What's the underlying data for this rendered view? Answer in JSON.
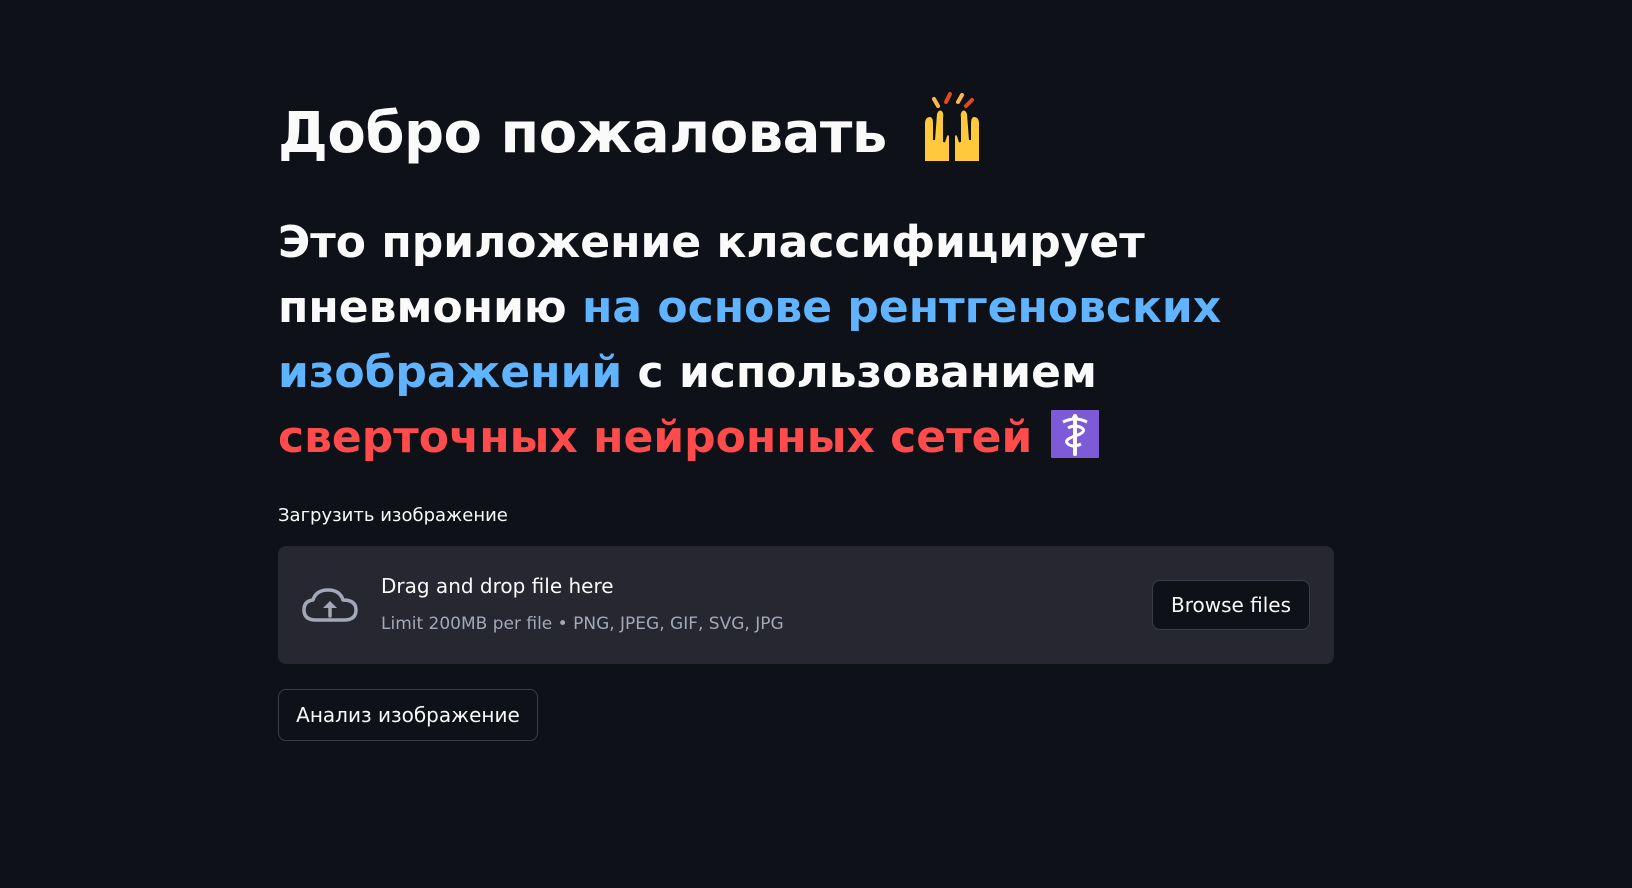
{
  "header": {
    "title": "Добро пожаловать",
    "title_emoji": "raising-hands-icon"
  },
  "intro": {
    "part1": "Это приложение классифицирует пневмонию ",
    "part2_blue": "на основе рентгеновских изображений",
    "part3": " с использованием ",
    "part4_red": "сверточных нейронных сетей",
    "trailing_emoji": "medical-symbol-icon"
  },
  "uploader": {
    "label": "Загрузить изображение",
    "drop_text": "Drag and drop file here",
    "limit_text": "Limit 200MB per file • PNG, JPEG, GIF, SVG, JPG",
    "browse_label": "Browse files",
    "icon": "cloud-upload-icon"
  },
  "actions": {
    "analyze_label": "Анализ изображение"
  },
  "colors": {
    "background": "#0e1117",
    "panel": "#262730",
    "blue_text": "#60b4ff",
    "red_text": "#ff4b4b",
    "medical_bg": "#7d5bd8"
  }
}
